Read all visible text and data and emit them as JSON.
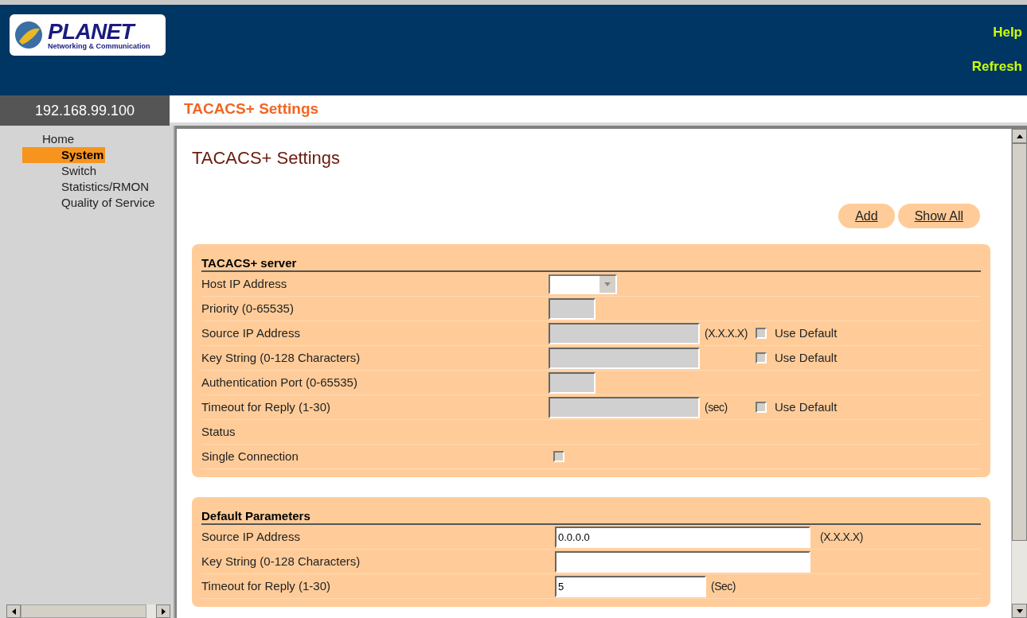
{
  "logo": {
    "name": "PLANET",
    "tagline": "Networking & Communication"
  },
  "header": {
    "links": [
      "Help",
      "Refresh"
    ]
  },
  "ip_address": "192.168.99.100",
  "page_title": "TACACS+ Settings",
  "sidebar": {
    "items": [
      {
        "label": "Home",
        "selected": false,
        "children": [
          {
            "label": "System",
            "selected": true
          },
          {
            "label": "Switch",
            "selected": false
          },
          {
            "label": "Statistics/RMON",
            "selected": false
          },
          {
            "label": "Quality of Service",
            "selected": false
          }
        ]
      }
    ]
  },
  "content": {
    "heading": "TACACS+ Settings",
    "buttons": [
      "Add",
      "Show All"
    ],
    "sections": [
      {
        "title": "TACACS+ server",
        "rows": [
          {
            "label": "Host IP Address",
            "kind": "select",
            "disabled": false
          },
          {
            "label": "Priority (0-65535)",
            "kind": "short",
            "disabled": true
          },
          {
            "label": "Source IP Address",
            "kind": "long",
            "disabled": true,
            "unit": "(X.X.X.X)",
            "use_default": {
              "label": "Use Default",
              "checked": false
            }
          },
          {
            "label": "Key String (0-128 Characters)",
            "kind": "long",
            "disabled": true,
            "use_default": {
              "label": "Use Default",
              "checked": false
            }
          },
          {
            "label": "Authentication Port (0-65535)",
            "kind": "short",
            "disabled": true
          },
          {
            "label": "Timeout for Reply (1-30)",
            "kind": "long",
            "disabled": true,
            "unit": "(sec)",
            "use_default": {
              "label": "Use Default",
              "checked": false
            }
          },
          {
            "label": "Status",
            "kind": "none"
          },
          {
            "label": "Single Connection",
            "kind": "checkbox",
            "checked": false
          }
        ]
      },
      {
        "title": "Default Parameters",
        "rows": [
          {
            "label": "Source IP Address",
            "kind": "wide",
            "disabled": false,
            "value": "0.0.0.0",
            "unit": "(X.X.X.X)"
          },
          {
            "label": "Key String (0-128 Characters)",
            "kind": "wide",
            "disabled": false
          },
          {
            "label": "Timeout for Reply (1-30)",
            "kind": "medium",
            "disabled": false,
            "value": "5",
            "unit": "(Sec)"
          }
        ]
      }
    ]
  }
}
